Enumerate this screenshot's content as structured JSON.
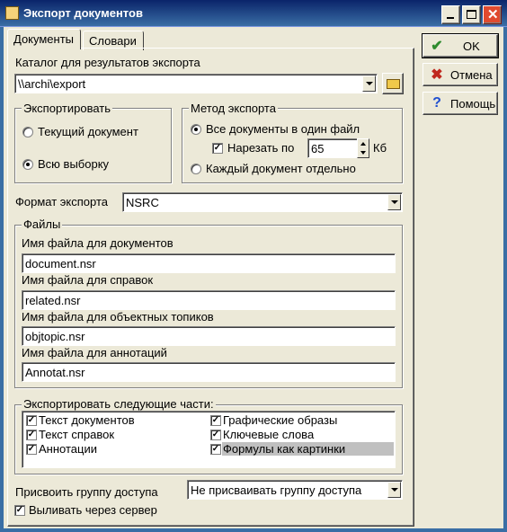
{
  "window": {
    "title": "Экспорт документов"
  },
  "tabs": [
    {
      "label": "Документы",
      "active": true
    },
    {
      "label": "Словари",
      "active": false
    }
  ],
  "buttons": {
    "ok": "OK",
    "cancel": "Отмена",
    "help": "Помощь"
  },
  "catalog": {
    "label": "Каталог для результатов экспорта",
    "value": "\\\\archi\\export"
  },
  "export_scope": {
    "legend": "Экспортировать",
    "options": [
      {
        "label": "Текущий документ",
        "selected": false
      },
      {
        "label": "Всю выборку",
        "selected": true
      }
    ]
  },
  "export_method": {
    "legend": "Метод экспорта",
    "all_in_one": "Все документы в один файл",
    "split_label": "Нарезать по",
    "split_value": "65",
    "split_unit": "Кб",
    "separate": "Каждый документ отдельно"
  },
  "format": {
    "label": "Формат экспорта",
    "value": "NSRC"
  },
  "files": {
    "legend": "Файлы",
    "doc_label": "Имя файла для документов",
    "doc_value": "document.nsr",
    "ref_label": "Имя файла для справок",
    "ref_value": "related.nsr",
    "obj_label": "Имя файла для объектных топиков",
    "obj_value": "objtopic.nsr",
    "ann_label": "Имя файла для аннотаций",
    "ann_value": "Annotat.nsr"
  },
  "parts": {
    "legend": "Экспортировать следующие части:",
    "items": [
      {
        "label": "Текст документов",
        "checked": true
      },
      {
        "label": "Графические образы",
        "checked": true
      },
      {
        "label": "Текст справок",
        "checked": true
      },
      {
        "label": "Ключевые слова",
        "checked": true
      },
      {
        "label": "Аннотации",
        "checked": true
      },
      {
        "label": "Формулы как картинки",
        "checked": true
      }
    ]
  },
  "access_group": {
    "label": "Присвоить группу доступа",
    "value": "Не присваивать группу доступа"
  },
  "via_server": {
    "label": "Выливать через сервер",
    "checked": true
  },
  "colors": {
    "window_bg": "#ece9d8",
    "title_bar": "#0a246a",
    "ok_check": "#2e8b2e",
    "cancel_x": "#c0281e",
    "help_q": "#1f4fd0",
    "selection": "#c0c0c0"
  }
}
